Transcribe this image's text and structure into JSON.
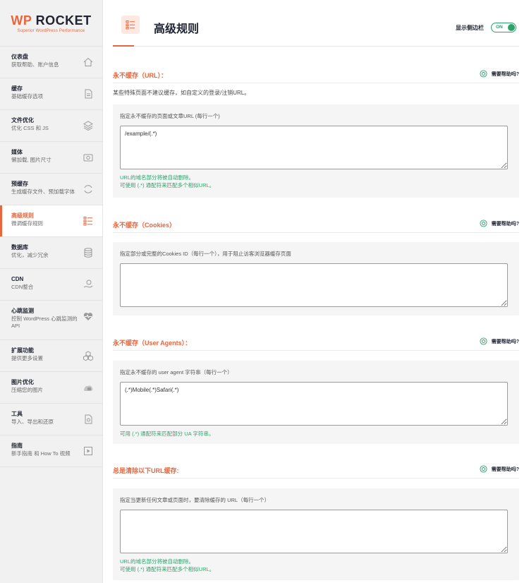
{
  "logo": {
    "wp": "WP",
    "rocket": "ROCKET",
    "tagline": "Superior WordPress Performance"
  },
  "sidebar": {
    "items": [
      {
        "title": "仪表盘",
        "desc": "获取帮助、账户信息",
        "icon": "home-icon"
      },
      {
        "title": "缓存",
        "desc": "基础缓存选项",
        "icon": "file-icon"
      },
      {
        "title": "文件优化",
        "desc": "优化 CSS 和 JS",
        "icon": "layers-icon"
      },
      {
        "title": "媒体",
        "desc": "懒加载, 图片尺寸",
        "icon": "image-icon"
      },
      {
        "title": "预缓存",
        "desc": "生成缓存文件、预加载字体",
        "icon": "refresh-icon"
      },
      {
        "title": "高级规则",
        "desc": "微调缓存规则",
        "icon": "list-icon"
      },
      {
        "title": "数据库",
        "desc": "优化，减少冗余",
        "icon": "database-icon"
      },
      {
        "title": "CDN",
        "desc": "CDN整合",
        "icon": "cdn-icon"
      },
      {
        "title": "心跳监测",
        "desc": "控制 WordPress 心跳监测的 API",
        "icon": "heartbeat-icon"
      },
      {
        "title": "扩展功能",
        "desc": "提供更多设置",
        "icon": "addons-icon"
      },
      {
        "title": "图片优化",
        "desc": "压缩您的图片",
        "icon": "image-optimize-icon"
      },
      {
        "title": "工具",
        "desc": "导入、导出和还原",
        "icon": "tools-icon"
      },
      {
        "title": "指南",
        "desc": "新手指南 和 How To 视频",
        "icon": "play-icon"
      }
    ]
  },
  "header": {
    "title": "高级规则",
    "toggle_label": "显示侧边栏",
    "toggle_state": "ON"
  },
  "help_text": "需要帮助吗?",
  "sections": [
    {
      "title": "永不缓存（URL）：",
      "desc": "某些特殊页面不建议缓存，如自定义的登录/注销URL。",
      "label": "指定永不缓存的页面或文章URL (每行一个)",
      "value": "/example/(.*)",
      "hints": [
        "URL的域名部分将被自动删除。",
        "可使用 (.*) 通配符来匹配多个相似URL。"
      ]
    },
    {
      "title": "永不缓存（Cookies）",
      "label": "指定部分或完整的Cookies ID（每行一个），用于阻止访客浏览器缓存页面",
      "value": ""
    },
    {
      "title": "永不缓存（User Agents）：",
      "label": "指定永不缓存的 user agent 字符串（每行一个）",
      "value": "(.*)Mobile(.*)Safari(.*)",
      "hints": [
        "可用 (.*) 通配符来匹配部分 UA 字符串。"
      ]
    },
    {
      "title": "总是清除以下URL缓存:",
      "label": "指定当更新任何文章或页面时，要清除缓存的 URL（每行一个）",
      "value": "",
      "hints": [
        "URL的域名部分将被自动删除。",
        "可使用 (.*) 通配符来匹配多个相似URL。"
      ]
    }
  ],
  "colors": {
    "accent": "#e8663d",
    "success": "#2aa36b",
    "text": "#1f2332"
  }
}
